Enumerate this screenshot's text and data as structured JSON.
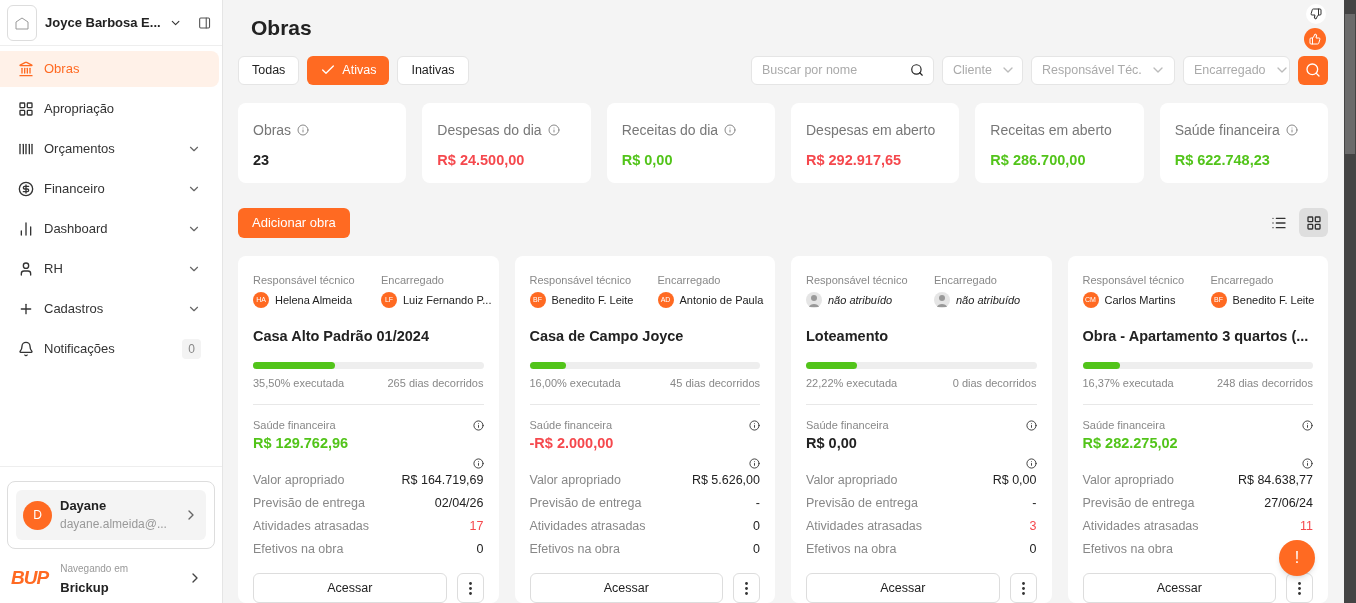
{
  "sidebar": {
    "company": "Joyce Barbosa E...",
    "items": [
      {
        "label": "Obras",
        "selected": true,
        "expandable": false
      },
      {
        "label": "Apropriação",
        "selected": false,
        "expandable": false
      },
      {
        "label": "Orçamentos",
        "selected": false,
        "expandable": true
      },
      {
        "label": "Financeiro",
        "selected": false,
        "expandable": true
      },
      {
        "label": "Dashboard",
        "selected": false,
        "expandable": true
      },
      {
        "label": "RH",
        "selected": false,
        "expandable": true
      },
      {
        "label": "Cadastros",
        "selected": false,
        "expandable": true
      },
      {
        "label": "Notificações",
        "selected": false,
        "expandable": false,
        "badge": "0"
      }
    ],
    "user": {
      "initial": "D",
      "name": "Dayane",
      "email": "dayane.almeida@..."
    },
    "workspace": {
      "logo": "BUP",
      "caption": "Navegando em",
      "name": "Brickup"
    }
  },
  "page_title": "Obras",
  "tabs": [
    {
      "label": "Todas",
      "selected": false
    },
    {
      "label": "Ativas",
      "selected": true
    },
    {
      "label": "Inativas",
      "selected": false
    }
  ],
  "search": {
    "placeholder": "Buscar por nome"
  },
  "filters": [
    {
      "placeholder": "Cliente"
    },
    {
      "placeholder": "Responsável Téc."
    },
    {
      "placeholder": "Encarregado"
    }
  ],
  "stats": [
    {
      "label": "Obras",
      "value": "23",
      "color": "#222222",
      "info": true
    },
    {
      "label": "Despesas do dia",
      "value": "R$ 24.500,00",
      "color": "#f5484d",
      "info": true
    },
    {
      "label": "Receitas do dia",
      "value": "R$ 0,00",
      "color": "#52c41a",
      "info": true
    },
    {
      "label": "Despesas em aberto",
      "value": "R$ 292.917,65",
      "color": "#f5484d",
      "info": false
    },
    {
      "label": "Receitas em aberto",
      "value": "R$ 286.700,00",
      "color": "#52c41a",
      "info": false
    },
    {
      "label": "Saúde financeira",
      "value": "R$ 622.748,23",
      "color": "#52c41a",
      "info": true
    }
  ],
  "add_button": "Adicionar obra",
  "view_toggle": [
    {
      "selected": false
    },
    {
      "selected": true
    }
  ],
  "obras": [
    {
      "resp_label": "Responsável técnico",
      "resp": {
        "assigned": true,
        "initials": "HA",
        "name": "Helena Almeida"
      },
      "enc_label": "Encarregado",
      "enc": {
        "assigned": true,
        "initials": "LF",
        "name": "Luiz Fernando P..."
      },
      "title": "Casa Alto Padrão 01/2024",
      "level": 0.355,
      "progress": "35,50% executada",
      "days": "265 dias decorridos",
      "health_label": "Saúde financeira",
      "health": {
        "value": "R$ 129.762,96",
        "color": "#52c41a"
      },
      "rows": [
        {
          "label": "Valor apropriado",
          "value": "R$ 164.719,69",
          "alert": false
        },
        {
          "label": "Previsão de entrega",
          "value": "02/04/26",
          "alert": false
        },
        {
          "label": "Atividades atrasadas",
          "value": "17",
          "alert": true
        },
        {
          "label": "Efetivos na obra",
          "value": "0",
          "alert": false
        }
      ],
      "access": "Acessar"
    },
    {
      "resp_label": "Responsável técnico",
      "resp": {
        "assigned": true,
        "initials": "BF",
        "name": "Benedito F. Leite"
      },
      "enc_label": "Encarregado",
      "enc": {
        "assigned": true,
        "initials": "AD",
        "name": "Antonio de Paula"
      },
      "title": "Casa de Campo Joyce",
      "level": 0.16,
      "progress": "16,00% executada",
      "days": "45 dias decorridos",
      "health_label": "Saúde financeira",
      "health": {
        "value": "-R$ 2.000,00",
        "color": "#f5484d"
      },
      "rows": [
        {
          "label": "Valor apropriado",
          "value": "R$ 5.626,00",
          "alert": false
        },
        {
          "label": "Previsão de entrega",
          "value": "-",
          "alert": false
        },
        {
          "label": "Atividades atrasadas",
          "value": "0",
          "alert": false
        },
        {
          "label": "Efetivos na obra",
          "value": "0",
          "alert": false
        }
      ],
      "access": "Acessar"
    },
    {
      "resp_label": "Responsável técnico",
      "resp": {
        "assigned": false,
        "name": "não atribuído"
      },
      "enc_label": "Encarregado",
      "enc": {
        "assigned": false,
        "name": "não atribuído"
      },
      "title": "Loteamento",
      "level": 0.2222,
      "progress": "22,22% executada",
      "days": "0 dias decorridos",
      "health_label": "Saúde financeira",
      "health": {
        "value": "R$ 0,00",
        "color": "#222222"
      },
      "rows": [
        {
          "label": "Valor apropriado",
          "value": "R$ 0,00",
          "alert": false
        },
        {
          "label": "Previsão de entrega",
          "value": "-",
          "alert": false
        },
        {
          "label": "Atividades atrasadas",
          "value": "3",
          "alert": true
        },
        {
          "label": "Efetivos na obra",
          "value": "0",
          "alert": false
        }
      ],
      "access": "Acessar"
    },
    {
      "resp_label": "Responsável técnico",
      "resp": {
        "assigned": true,
        "initials": "CM",
        "name": "Carlos Martins"
      },
      "enc_label": "Encarregado",
      "enc": {
        "assigned": true,
        "initials": "BF",
        "name": "Benedito F. Leite"
      },
      "title": "Obra - Apartamento 3 quartos (...",
      "level": 0.1637,
      "progress": "16,37% executada",
      "days": "248 dias decorridos",
      "health_label": "Saúde financeira",
      "health": {
        "value": "R$ 282.275,02",
        "color": "#52c41a"
      },
      "rows": [
        {
          "label": "Valor apropriado",
          "value": "R$ 84.638,77",
          "alert": false
        },
        {
          "label": "Previsão de entrega",
          "value": "27/06/24",
          "alert": false
        },
        {
          "label": "Atividades atrasadas",
          "value": "11",
          "alert": true
        },
        {
          "label": "Efetivos na obra"
        }
      ],
      "access": "Acessar"
    }
  ],
  "help_button": "!"
}
